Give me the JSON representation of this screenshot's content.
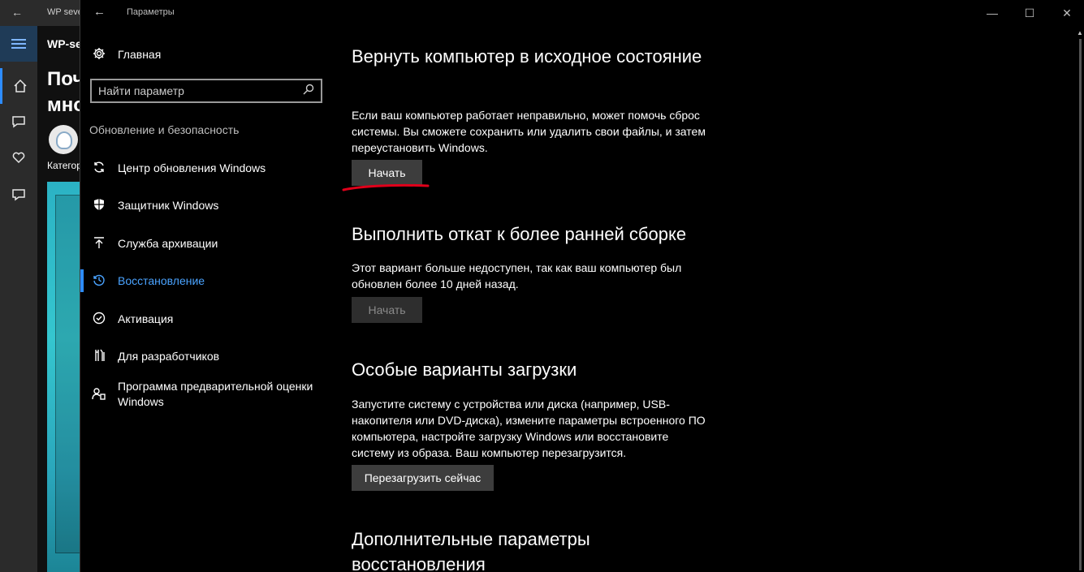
{
  "background_app": {
    "title": "WP seven",
    "brand": "WP-seven",
    "heading": "Почему много",
    "category": "Категория"
  },
  "window": {
    "title": "Параметры",
    "back_label": "←",
    "minimize": "—",
    "maximize": "☐",
    "close": "✕"
  },
  "nav": {
    "home_label": "Главная",
    "search_placeholder": "Найти параметр",
    "category": "Обновление и безопасность",
    "items": [
      {
        "label": "Центр обновления Windows",
        "icon": "sync-icon"
      },
      {
        "label": "Защитник Windows",
        "icon": "shield-icon"
      },
      {
        "label": "Служба архивации",
        "icon": "upload-icon"
      },
      {
        "label": "Восстановление",
        "icon": "history-icon",
        "active": true
      },
      {
        "label": "Активация",
        "icon": "check-circle-icon"
      },
      {
        "label": "Для разработчиков",
        "icon": "tools-icon"
      },
      {
        "label": "Программа предварительной оценки Windows",
        "icon": "insider-icon"
      }
    ]
  },
  "sections": {
    "reset": {
      "title": "Вернуть компьютер в исходное состояние",
      "text": "Если ваш компьютер работает неправильно, может помочь сброс системы. Вы сможете сохранить или удалить свои файлы, и затем переустановить Windows.",
      "button": "Начать"
    },
    "rollback": {
      "title": "Выполнить откат к более ранней сборке",
      "text": "Этот вариант больше недоступен, так как ваш компьютер был обновлен более 10 дней назад.",
      "button": "Начать"
    },
    "advanced_startup": {
      "title": "Особые варианты загрузки",
      "text": "Запустите систему с устройства или диска (например, USB-накопителя или DVD-диска), измените параметры встроенного ПО компьютера, настройте загрузку Windows или восстановите систему из образа. Ваш компьютер перезагрузится.",
      "button": "Перезагрузить сейчас"
    },
    "more": {
      "title": "Дополнительные параметры восстановления"
    }
  },
  "colors": {
    "accent": "#2d8cff",
    "annotation": "#e0001a"
  }
}
